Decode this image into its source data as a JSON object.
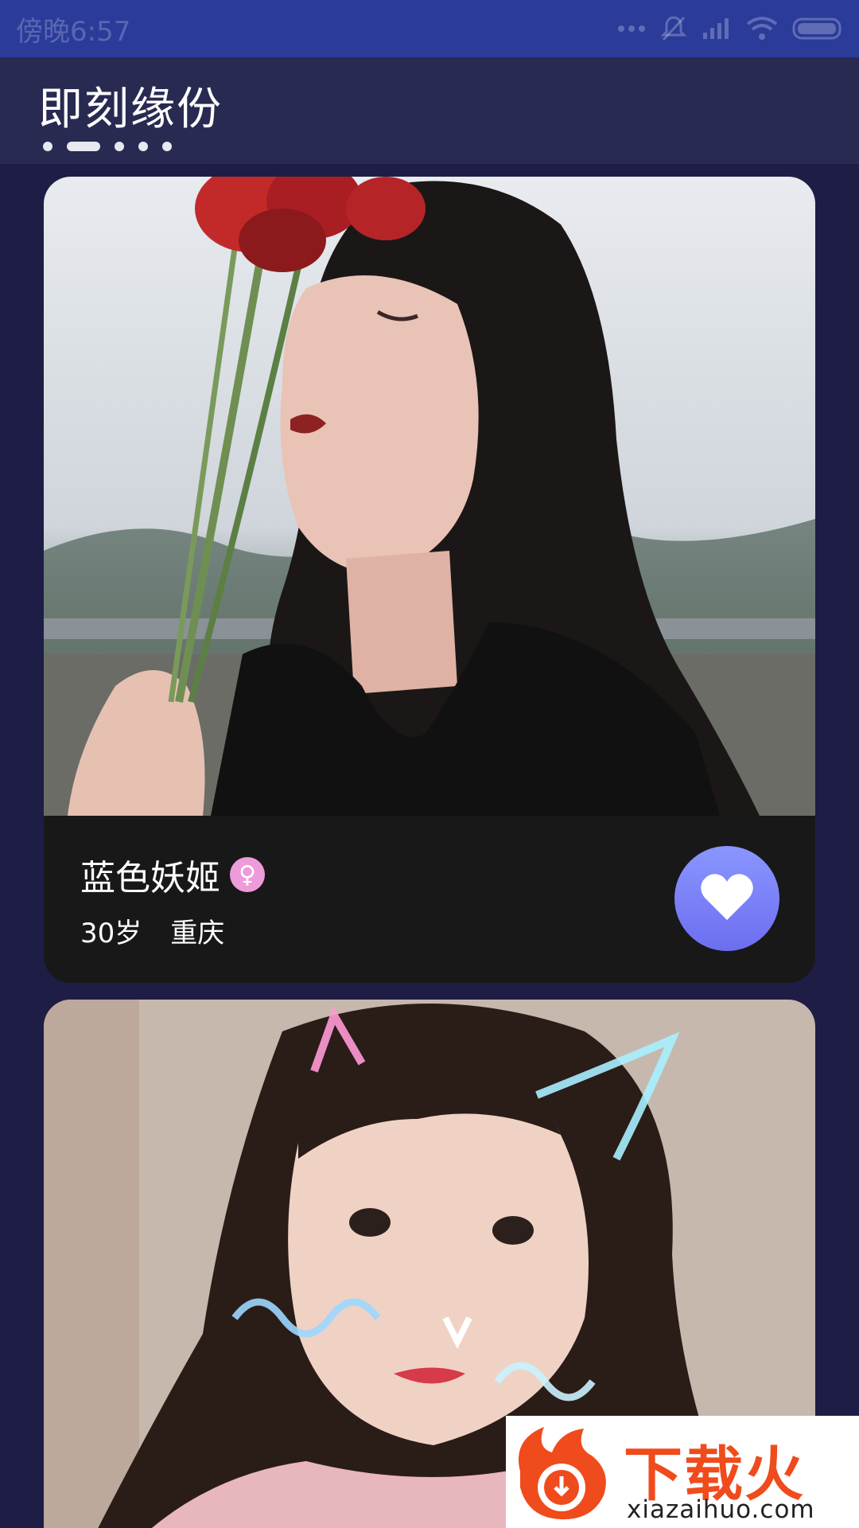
{
  "status_bar": {
    "time": "傍晚6:57",
    "icons": [
      "more-dots-icon",
      "mute-icon",
      "signal-icon",
      "wifi-icon",
      "battery-icon"
    ]
  },
  "header": {
    "title": "即刻缘份",
    "pager_dots": 5,
    "pager_active_index": 1
  },
  "cards": [
    {
      "name": "蓝色妖姬",
      "gender_icon": "female-icon",
      "gender_symbol": "♀",
      "age": "30岁",
      "city": "重庆",
      "like_icon": "heart-icon"
    },
    {
      "photo": "portrait-photo-2"
    }
  ],
  "watermark": {
    "cn": "下载火",
    "en": "xiazaihuo.com"
  },
  "colors": {
    "status_bar": "#2b3b9a",
    "header": "#292a52",
    "background": "#1e1d45",
    "card_info": "#181818",
    "like_button": "#7b80f5",
    "gender_badge": "#ee9bd9",
    "watermark_brand": "#f04b1c"
  }
}
